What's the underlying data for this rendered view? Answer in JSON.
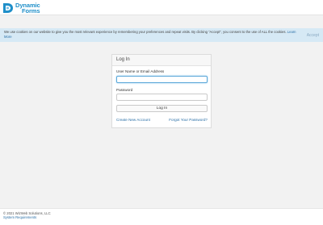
{
  "header": {
    "logo_line1": "Dynamic",
    "logo_line2": "Forms",
    "brand_color": "#1f8fc9"
  },
  "cookie_banner": {
    "text": "We use cookies on our website to give you the most relevant experience by remembering your preferences and repeat visits. By clicking “Accept”, you consent to the use of ALL the cookies.",
    "read_more": "Learn More",
    "accept_label": "Accept",
    "background": "#d6e9f5"
  },
  "login": {
    "title": "Log In",
    "username_label": "User Name or Email Address",
    "username_value": "",
    "password_label": "Password",
    "password_value": "",
    "submit_label": "Log In",
    "create_account": "Create New Account",
    "forgot_password": "Forgot Your Password?",
    "link_color": "#2a6fa6"
  },
  "footer": {
    "copyright": "© 2021 WizWeb Solutions, LLC",
    "system_requirements": "System Requirements"
  }
}
